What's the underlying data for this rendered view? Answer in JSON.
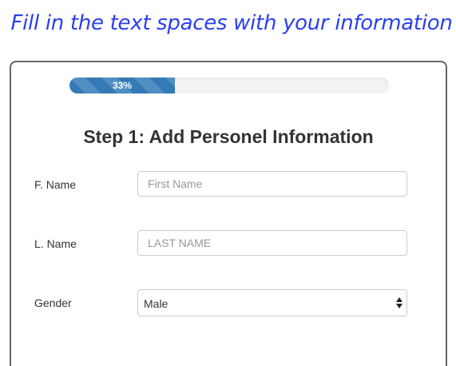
{
  "banner": {
    "text": "Fill in the text spaces with your information"
  },
  "progress": {
    "label": "33%",
    "value": 0.33,
    "color": "#337ab7"
  },
  "form": {
    "title": "Step 1: Add Personel Information",
    "first_name": {
      "label": "F. Name",
      "placeholder": "First Name",
      "value": ""
    },
    "last_name": {
      "label": "L. Name",
      "placeholder": "LAST NAME",
      "value": ""
    },
    "gender": {
      "label": "Gender",
      "selected": "Male"
    }
  },
  "colors": {
    "banner": "#2a3ff0",
    "border": "#666666"
  }
}
